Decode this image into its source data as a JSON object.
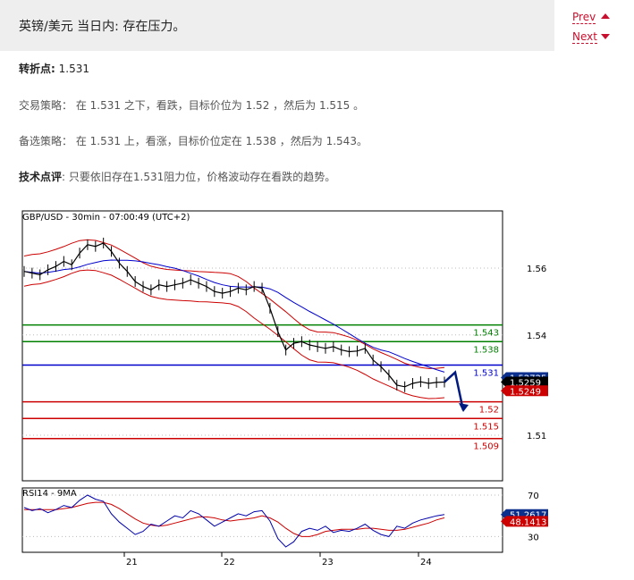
{
  "header": {
    "title": "英镑/美元 当日内: 存在压力。"
  },
  "nav": {
    "prev_label": "Prev",
    "next_label": "Next"
  },
  "content": {
    "pivot_label": "转折点:",
    "pivot_value": "1.531",
    "strategy": "交易策略： 在 1.531 之下，看跌，目标价位为 1.52 ，然后为 1.515 。",
    "alternative": "备选策略： 在 1.531 上，看涨，目标价位定在 1.538 ，然后为 1.543。",
    "comment_label": "技术点评",
    "comment_text": ": 只要依旧存在1.531阻力位，价格波动存在看跌的趋势。"
  },
  "chart_data": {
    "type": "line",
    "title": "GBP/USD - 30min - 07:00:49 (UTC+2)",
    "price_ticks": [
      "1.56",
      "1.54",
      "1.51"
    ],
    "price_tick_values": [
      1.56,
      1.54,
      1.51
    ],
    "levels": [
      {
        "label": "1.543",
        "value": 1.543,
        "color": "#008000"
      },
      {
        "label": "1.538",
        "value": 1.538,
        "color": "#008000"
      },
      {
        "label": "1.531",
        "value": 1.531,
        "color": "#0000cc"
      },
      {
        "label": "1.52",
        "value": 1.52,
        "color": "#cc0000"
      },
      {
        "label": "1.515",
        "value": 1.515,
        "color": "#cc0000"
      },
      {
        "label": "1.509",
        "value": 1.509,
        "color": "#cc0000"
      }
    ],
    "price_tags": [
      {
        "label": "1.52725",
        "value": 1.52725,
        "color": "#0a2f8c"
      },
      {
        "label": "1.5259",
        "value": 1.5259,
        "color": "#000000"
      },
      {
        "label": "1.5249",
        "value": 1.5249,
        "color": "#cc0000"
      }
    ],
    "x_labels": [
      "21",
      "22",
      "23",
      "24"
    ],
    "price_series": [
      1.559,
      1.5585,
      1.558,
      1.5595,
      1.5605,
      1.562,
      1.561,
      1.5645,
      1.567,
      1.5665,
      1.5675,
      1.565,
      1.5615,
      1.559,
      1.556,
      1.5545,
      1.5535,
      1.555,
      1.5545,
      1.555,
      1.5555,
      1.5565,
      1.5555,
      1.5545,
      1.553,
      1.5525,
      1.553,
      1.554,
      1.5535,
      1.5545,
      1.554,
      1.548,
      1.541,
      1.5355,
      1.5375,
      1.538,
      1.537,
      1.5365,
      1.536,
      1.5365,
      1.5355,
      1.535,
      1.5352,
      1.536,
      1.5325,
      1.5305,
      1.528,
      1.525,
      1.5245,
      1.5255,
      1.526,
      1.5255,
      1.5258,
      1.5259
    ],
    "indicator": {
      "title": "RSI14 - 9MA",
      "ticks": [
        "70",
        "30"
      ],
      "tick_values": [
        70,
        30
      ],
      "rsi_label": "51.2617",
      "rsi_value": 51.2617,
      "ma_label": "48.1413",
      "ma_value": 48.1413,
      "rsi_series": [
        58,
        55,
        57,
        53,
        56,
        60,
        58,
        65,
        70,
        66,
        64,
        52,
        44,
        38,
        32,
        35,
        42,
        40,
        45,
        50,
        48,
        55,
        52,
        46,
        40,
        44,
        48,
        52,
        50,
        54,
        55,
        45,
        28,
        20,
        25,
        35,
        38,
        36,
        40,
        34,
        36,
        35,
        38,
        42,
        36,
        32,
        30,
        40,
        38,
        43,
        46,
        48,
        50,
        51.26
      ],
      "ma_series": [
        56,
        56,
        56,
        56,
        56,
        57,
        58,
        60,
        62,
        63,
        63,
        61,
        57,
        52,
        47,
        43,
        41,
        40,
        41,
        43,
        45,
        47,
        49,
        49,
        48,
        46,
        45,
        46,
        47,
        48,
        50,
        48,
        44,
        38,
        33,
        30,
        30,
        32,
        35,
        36,
        37,
        37,
        37,
        38,
        38,
        37,
        36,
        36,
        37,
        39,
        41,
        43,
        46,
        48.14
      ]
    }
  }
}
